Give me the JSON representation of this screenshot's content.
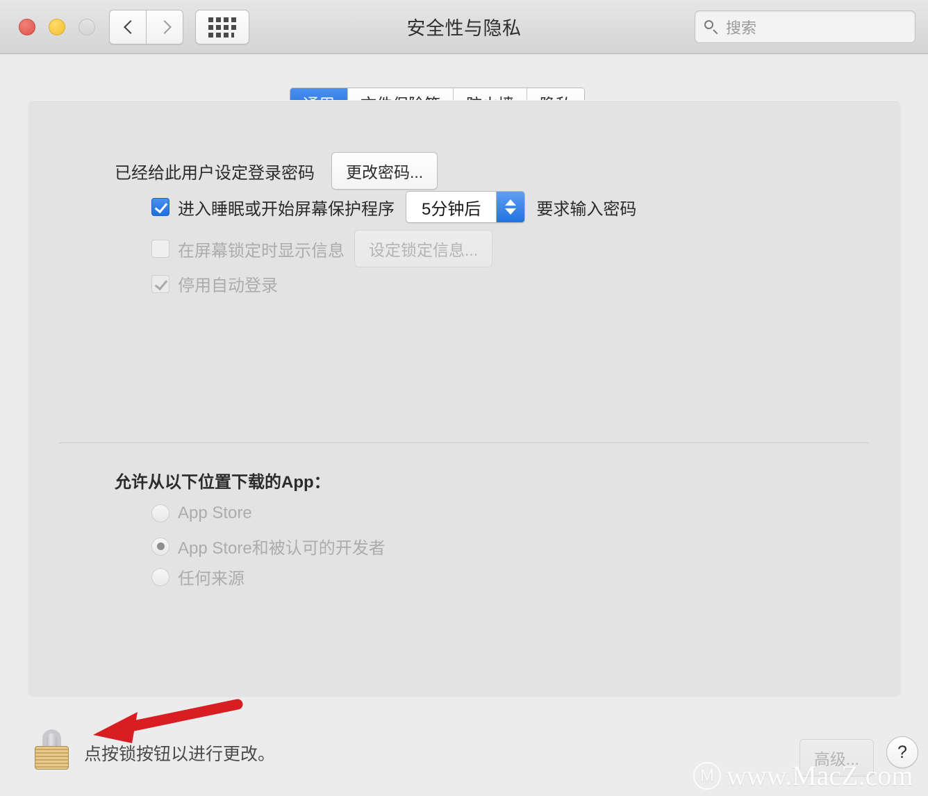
{
  "window": {
    "title": "安全性与隐私",
    "traffic_lights": [
      {
        "name": "close",
        "color": "#dd5248"
      },
      {
        "name": "minimize",
        "color": "#f2bd30"
      },
      {
        "name": "zoom",
        "color": "#d6d6d6"
      }
    ],
    "nav": {
      "back_icon": "chevron-left-icon",
      "forward_icon": "chevron-right-icon",
      "grid_icon": "grid-icon"
    },
    "search": {
      "placeholder": "搜索",
      "value": "",
      "icon": "search-icon"
    }
  },
  "tabs": [
    {
      "label": "通用",
      "selected": true
    },
    {
      "label": "文件保险箱",
      "selected": false
    },
    {
      "label": "防火墙",
      "selected": false
    },
    {
      "label": "隐私",
      "selected": false
    }
  ],
  "general": {
    "password_status": "已经给此用户设定登录密码",
    "change_password_button": "更改密码...",
    "require_password": {
      "label": "进入睡眠或开始屏幕保护程序",
      "checked": true,
      "enabled": true,
      "delay_value": "5分钟后",
      "suffix": "要求输入密码"
    },
    "lock_message": {
      "label": "在屏幕锁定时显示信息",
      "checked": false,
      "enabled": false,
      "button": "设定锁定信息..."
    },
    "disable_auto_login": {
      "label": "停用自动登录",
      "checked": true,
      "enabled": false
    }
  },
  "downloads": {
    "heading": "允许从以下位置下载的App：",
    "options": [
      {
        "label": "App Store",
        "selected": false
      },
      {
        "label": "App Store和被认可的开发者",
        "selected": true
      },
      {
        "label": "任何来源",
        "selected": false
      }
    ]
  },
  "footer": {
    "lock_icon": "lock-closed-icon",
    "lock_state": "locked",
    "hint": "点按锁按钮以进行更改。",
    "arrow_icon": "red-arrow-left-icon",
    "advanced_button": "高级...",
    "advanced_enabled": false,
    "help_button": "?"
  },
  "watermark": {
    "logo": "Ⓜ",
    "text": "www.MacZ.com"
  },
  "colors": {
    "accent_blue": "#2173e2",
    "window_bg": "#ececec",
    "panel_bg": "#e3e3e3",
    "arrow_red": "#d81e22",
    "lock_gold": "#d9b26b"
  }
}
